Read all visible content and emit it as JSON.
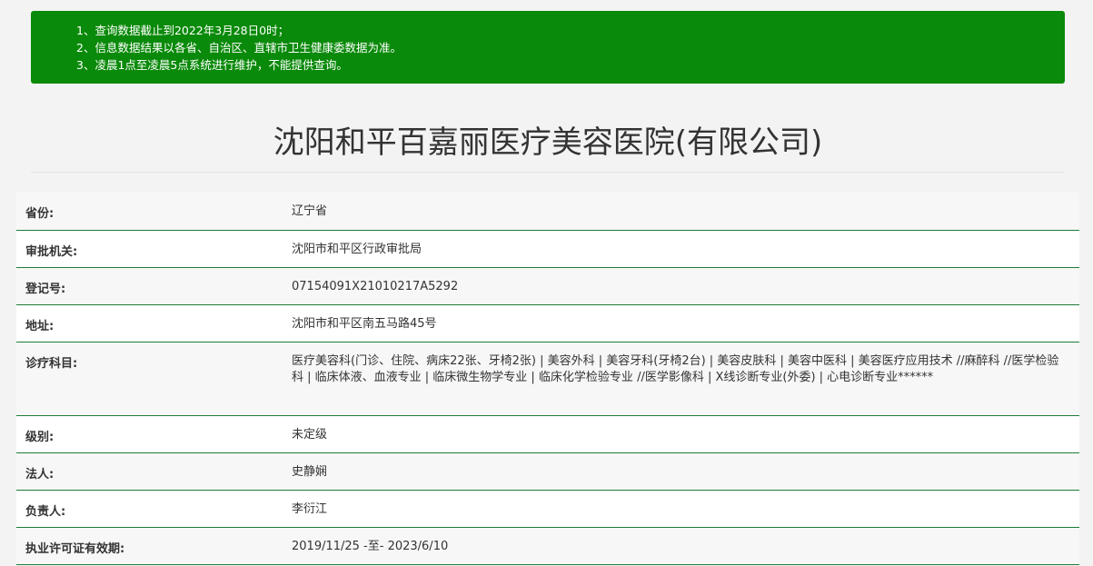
{
  "notice": {
    "lines": [
      "1、查询数据截止到2022年3月28日0时；",
      "2、信息数据结果以各省、自治区、直辖市卫生健康委数据为准。",
      "3、凌晨1点至凌晨5点系统进行维护，不能提供查询。"
    ]
  },
  "page": {
    "title": "沈阳和平百嘉丽医疗美容医院(有限公司)"
  },
  "info": {
    "rows": [
      {
        "label": "省份:",
        "value": "辽宁省"
      },
      {
        "label": "审批机关:",
        "value": "沈阳市和平区行政审批局"
      },
      {
        "label": "登记号:",
        "value": "07154091X21010217A5292"
      },
      {
        "label": "地址:",
        "value": "沈阳市和平区南五马路45号"
      },
      {
        "label": "诊疗科目:",
        "value": "医疗美容科(门诊、住院、病床22张、牙椅2张) | 美容外科 | 美容牙科(牙椅2台) | 美容皮肤科 | 美容中医科 | 美容医疗应用技术 //麻醉科 //医学检验科 | 临床体液、血液专业 | 临床微生物学专业 | 临床化学检验专业 //医学影像科 | X线诊断专业(外委) | 心电诊断专业******"
      },
      {
        "label": "级别:",
        "value": "未定级"
      },
      {
        "label": "法人:",
        "value": "史静娴"
      },
      {
        "label": "负责人:",
        "value": "李衍江"
      },
      {
        "label": "执业许可证有效期:",
        "value": "2019/11/25 -至- 2023/6/10"
      }
    ]
  }
}
